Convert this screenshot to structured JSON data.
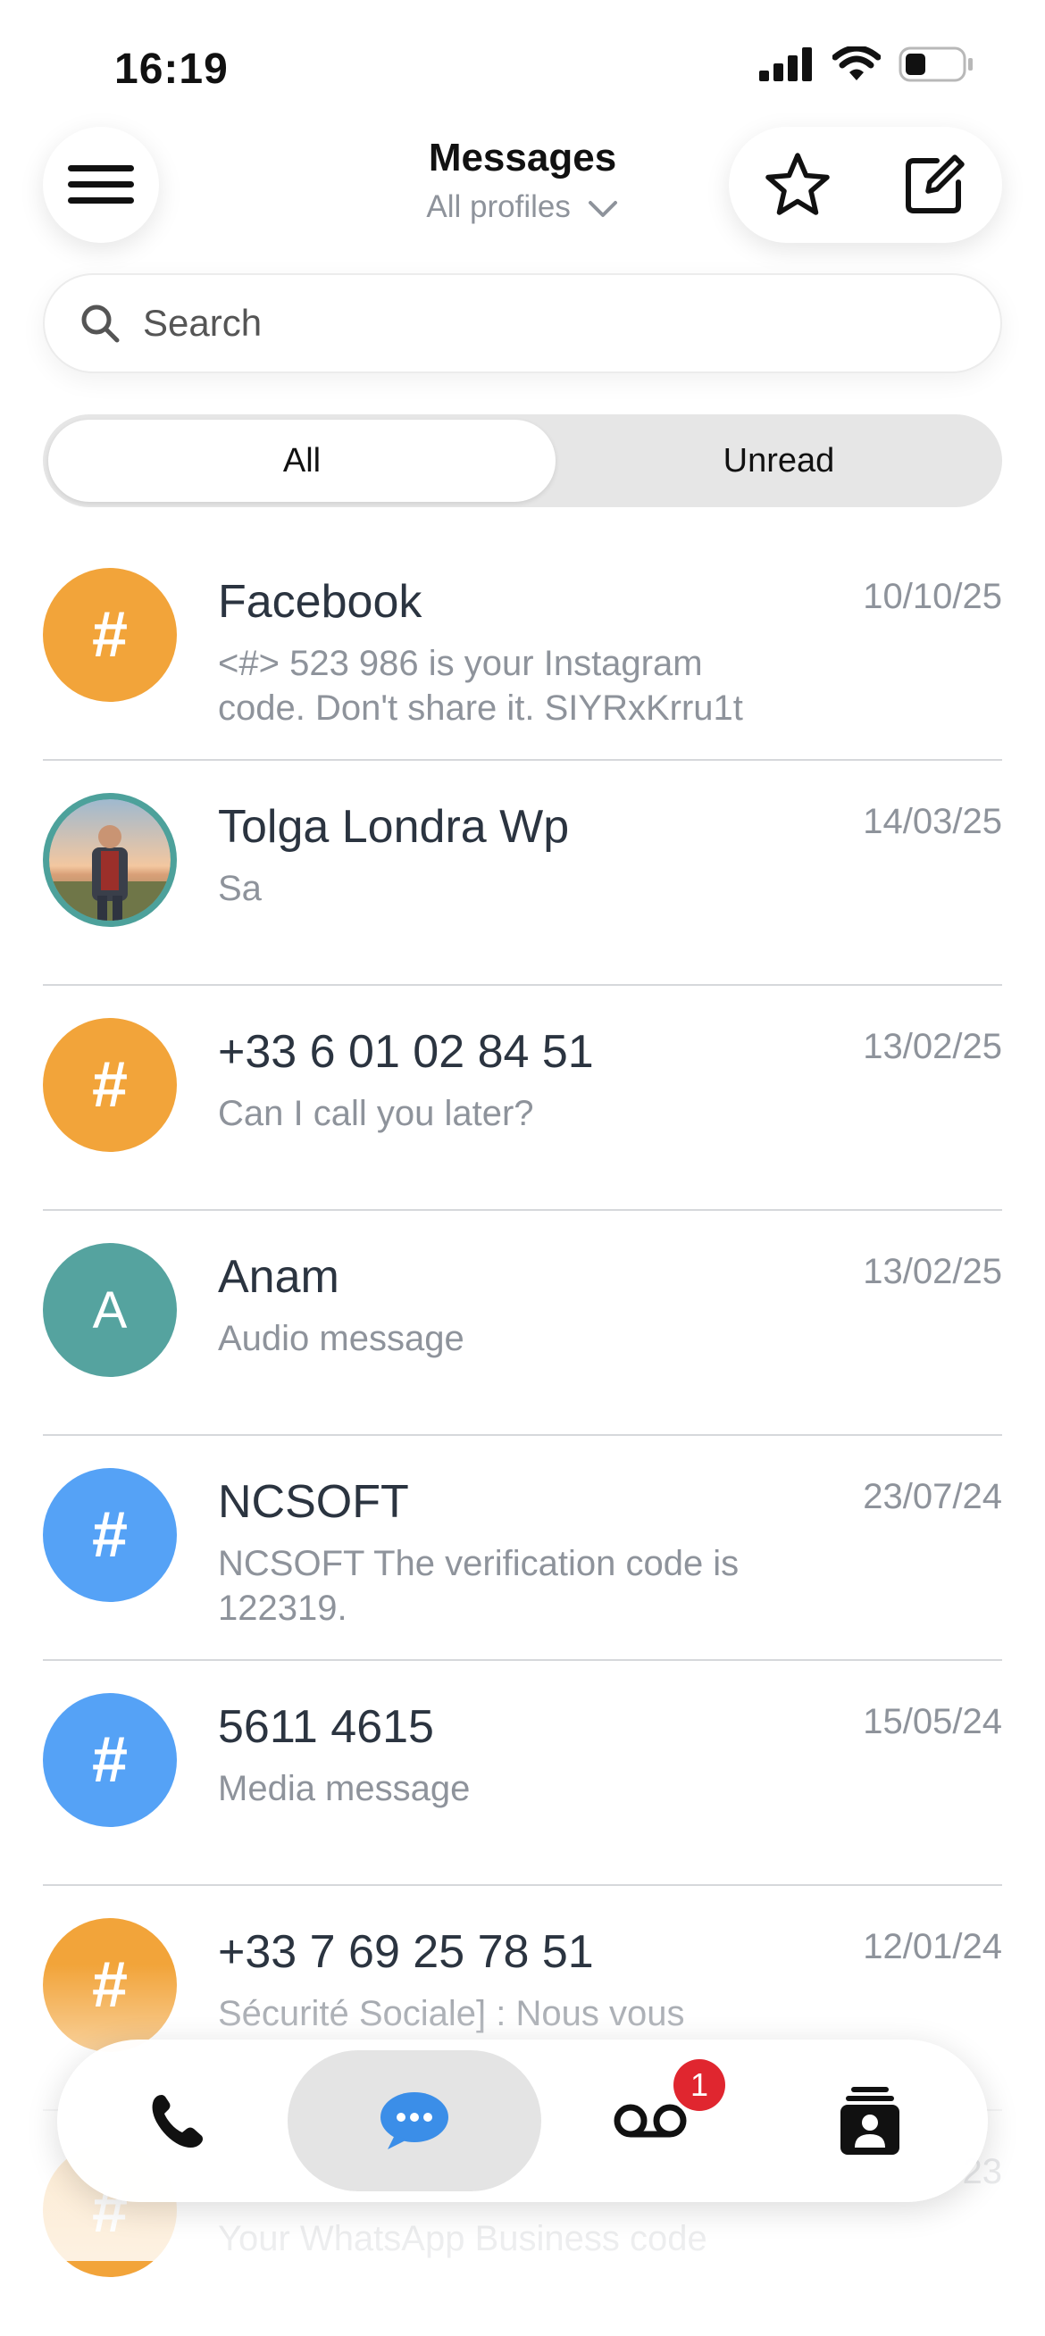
{
  "status_bar": {
    "time": "16:19"
  },
  "header": {
    "title": "Messages",
    "profile_selector": "All profiles",
    "menu_icon": "hamburger-menu-icon",
    "favorites_icon": "star-icon",
    "compose_icon": "compose-icon"
  },
  "search": {
    "placeholder": "Search"
  },
  "filter_tabs": [
    {
      "label": "All",
      "selected": true
    },
    {
      "label": "Unread",
      "selected": false
    }
  ],
  "conversations": [
    {
      "name": "Facebook",
      "date": "10/10/25",
      "preview": "<#> 523 986 is your Instagram code. Don't share it. SIYRxKrru1t",
      "avatar": {
        "type": "hash",
        "text": "#",
        "color": "#f2a43a"
      }
    },
    {
      "name": "Tolga Londra Wp",
      "date": "14/03/25",
      "preview": "Sa",
      "avatar": {
        "type": "photo",
        "ring_color": "#4da19b"
      }
    },
    {
      "name": "+33 6 01 02 84 51",
      "date": "13/02/25",
      "preview": "Can I call you later?",
      "avatar": {
        "type": "hash",
        "text": "#",
        "color": "#f2a43a"
      }
    },
    {
      "name": "Anam",
      "date": "13/02/25",
      "preview": "Audio message",
      "avatar": {
        "type": "letter",
        "text": "A",
        "color": "#55a39f"
      }
    },
    {
      "name": "NCSOFT",
      "date": "23/07/24",
      "preview": "NCSOFT The verification code is 122319.",
      "avatar": {
        "type": "hash",
        "text": "#",
        "color": "#55a2f6"
      }
    },
    {
      "name": "5611 4615",
      "date": "15/05/24",
      "preview": "Media message",
      "avatar": {
        "type": "hash",
        "text": "#",
        "color": "#55a2f6"
      }
    },
    {
      "name": "+33 7 69 25 78 51",
      "date": "12/01/24",
      "preview": "Sécurité Sociale] : Nous vous",
      "avatar": {
        "type": "hash",
        "text": "#",
        "color": "#f2a43a"
      }
    },
    {
      "name": "",
      "date": "23",
      "preview": "Your WhatsApp Business code",
      "avatar": {
        "type": "hash",
        "text": "#",
        "color": "#f2a43a"
      }
    }
  ],
  "tab_bar": {
    "items": [
      {
        "icon": "phone-icon",
        "active": false
      },
      {
        "icon": "chat-bubble-icon",
        "active": true
      },
      {
        "icon": "voicemail-icon",
        "active": false,
        "badge": "1"
      },
      {
        "icon": "contacts-icon",
        "active": false
      }
    ]
  },
  "colors": {
    "accent_blue": "#3b8ee8",
    "orange_avatar": "#f2a43a",
    "teal_avatar": "#55a39f",
    "blue_avatar": "#55a2f6",
    "badge_red": "#e0262f",
    "secondary_text": "#8e939b"
  }
}
